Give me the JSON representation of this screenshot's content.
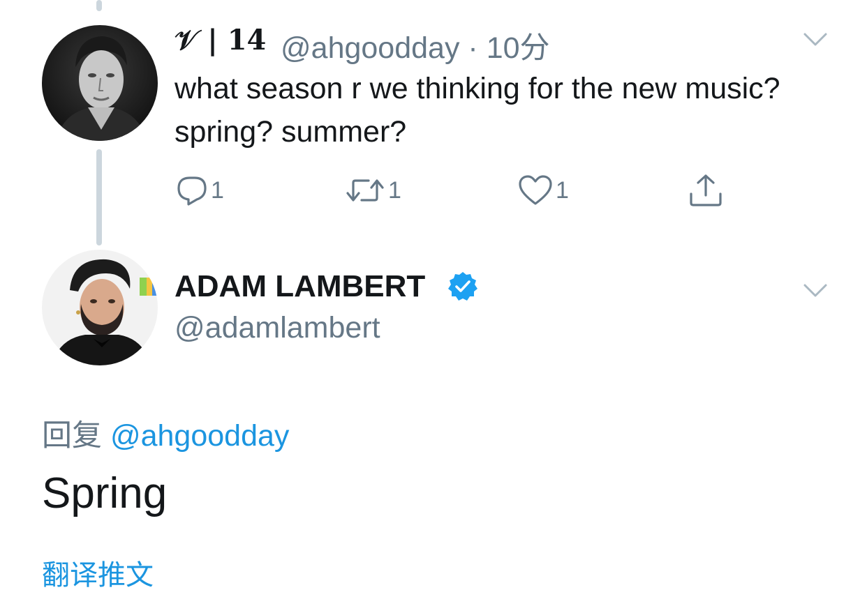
{
  "parent_tweet": {
    "display_name": "𝒱 | 14",
    "handle": "@ahgoodday",
    "timestamp": "· 10分",
    "text": "what season r we thinking for the new music?  spring?  summer?",
    "reply_count": "1",
    "retweet_count": "1",
    "like_count": "1"
  },
  "reply_tweet": {
    "display_name": "ADAM LAMBERT",
    "handle": "@adamlambert",
    "replying_prefix": "回复",
    "replying_to": "@ahgoodday",
    "text": "Spring",
    "translate_label": "翻译推文"
  },
  "icons": {
    "reply": "reply-icon",
    "retweet": "retweet-icon",
    "like": "heart-icon",
    "share": "share-icon",
    "verified": "verified-badge-icon",
    "caret": "chevron-down-icon"
  },
  "colors": {
    "link": "#1b95e0",
    "secondary": "#657786",
    "verified": "#1da1f2",
    "thread_line": "#ccd6dd"
  }
}
